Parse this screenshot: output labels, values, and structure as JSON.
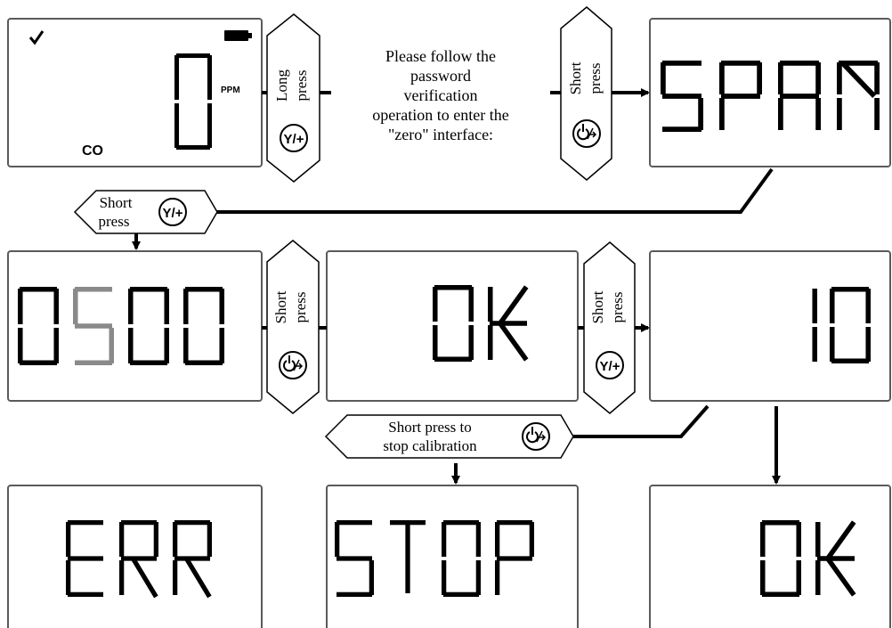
{
  "colors": {
    "border": "#5a5a5a",
    "segment": "#000000",
    "highlight_segment": "#8a8a8a",
    "line": "#000000"
  },
  "screens": {
    "main": {
      "value": "0",
      "unit": "PPM",
      "gas": "CO",
      "check_icon": "check-icon",
      "battery_icon": "battery-icon"
    },
    "span": {
      "value": "SPAN"
    },
    "set_value": {
      "digits": [
        "0",
        "5",
        "0",
        "0"
      ],
      "highlighted_index": 1
    },
    "ok1": {
      "value": "OK"
    },
    "countdown": {
      "value": "10"
    },
    "err": {
      "value": "ERR"
    },
    "stop": {
      "value": "STOP"
    },
    "ok2": {
      "value": "OK"
    }
  },
  "steps": {
    "long_press": {
      "lines": [
        "Long",
        "press"
      ],
      "button_icon": "y-plus-button-icon",
      "button_text": "Y/+"
    },
    "password_note": {
      "lines": [
        "Please follow the",
        "password",
        "verification",
        "operation to enter the",
        "\"zero\" interface:"
      ]
    },
    "short_press_power_1": {
      "lines": [
        "Short",
        "press"
      ],
      "button_icon": "power-arrow-button-icon"
    },
    "short_press_y": {
      "lines": [
        "Short",
        "press"
      ],
      "button_icon": "y-plus-button-icon",
      "button_text": "Y/+"
    },
    "short_press_power_2": {
      "lines": [
        "Short",
        "press"
      ],
      "button_icon": "power-arrow-button-icon"
    },
    "short_press_y_2": {
      "lines": [
        "Short",
        "press"
      ],
      "button_icon": "y-plus-button-icon",
      "button_text": "Y/+"
    },
    "stop_calibration": {
      "lines": [
        "Short press  to",
        "stop calibration"
      ],
      "button_icon": "power-arrow-button-icon"
    }
  }
}
